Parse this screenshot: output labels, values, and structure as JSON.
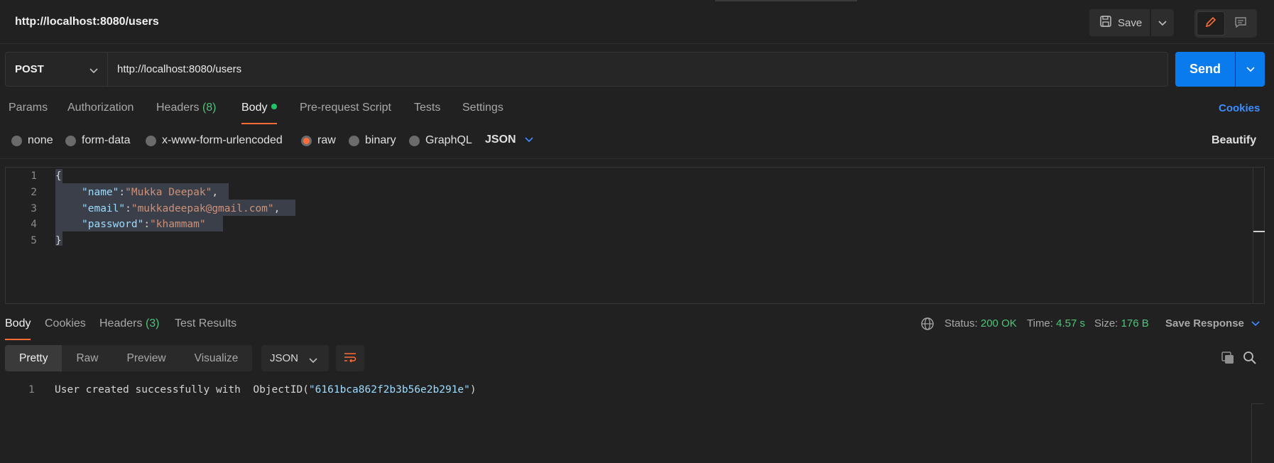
{
  "titlebar": {
    "title": "http://localhost:8080/users",
    "save_label": "Save"
  },
  "request": {
    "method": "POST",
    "url": "http://localhost:8080/users",
    "send_label": "Send"
  },
  "request_tabs": {
    "params": "Params",
    "authorization": "Authorization",
    "headers": "Headers",
    "headers_count": "(8)",
    "body": "Body",
    "prerequest": "Pre-request Script",
    "tests": "Tests",
    "settings": "Settings",
    "cookies": "Cookies"
  },
  "body_types": {
    "none": "none",
    "form_data": "form-data",
    "urlencoded": "x-www-form-urlencoded",
    "raw": "raw",
    "binary": "binary",
    "graphql": "GraphQL",
    "format": "JSON",
    "beautify": "Beautify",
    "selected": "raw"
  },
  "editor": {
    "line_numbers": [
      "1",
      "2",
      "3",
      "4",
      "5"
    ],
    "open_brace": "{",
    "close_brace": "}",
    "fields": [
      {
        "key": "\"name\"",
        "value": "\"Mukka Deepak\"",
        "trail": ","
      },
      {
        "key": "\"email\"",
        "value": "\"mukkadeepak@gmail.com\"",
        "trail": ","
      },
      {
        "key": "\"password\"",
        "value": "\"khammam\"",
        "trail": ""
      }
    ]
  },
  "response_tabs": {
    "body": "Body",
    "cookies": "Cookies",
    "headers": "Headers",
    "headers_count": "(3)",
    "test_results": "Test Results"
  },
  "response_status": {
    "status_label": "Status:",
    "status_value": "200 OK",
    "time_label": "Time:",
    "time_value": "4.57 s",
    "size_label": "Size:",
    "size_value": "176 B",
    "save_response": "Save Response"
  },
  "response_view": {
    "pretty": "Pretty",
    "raw": "Raw",
    "preview": "Preview",
    "visualize": "Visualize",
    "format": "JSON"
  },
  "response_body": {
    "line_number": "1",
    "text_prefix": "User created successfully with  ObjectID(",
    "object_id": "\"6161bca862f2b3b56e2b291e\"",
    "text_suffix": ")"
  },
  "colors": {
    "accent_orange": "#ff6c37",
    "send_blue": "#097bed",
    "link_blue": "#3d8dff",
    "status_green": "#4fc37a"
  }
}
